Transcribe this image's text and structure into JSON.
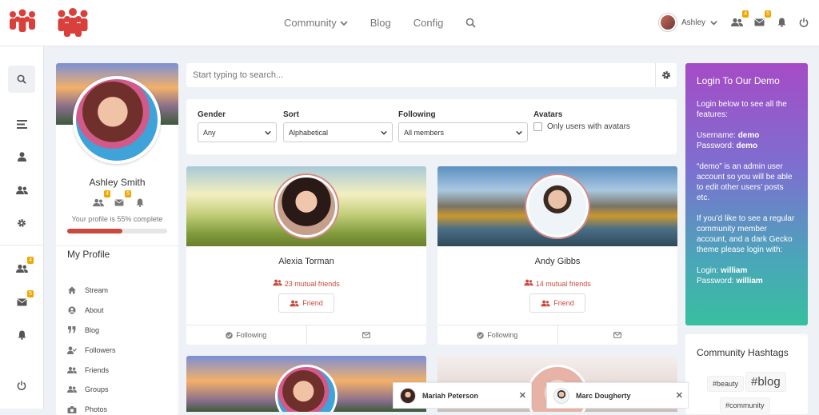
{
  "nav": {
    "community": "Community",
    "blog": "Blog",
    "config": "Config"
  },
  "user": {
    "name": "Ashley",
    "friend_requests_badge": "4",
    "messages_badge": "5"
  },
  "sidebar": {
    "friends_badge": "4",
    "messages_badge": "5"
  },
  "profile": {
    "name": "Ashley Smith",
    "friends_badge": "4",
    "messages_badge": "5",
    "completion_text": "Your profile is 55% complete",
    "completion_percent": 55,
    "menu_title": "My Profile",
    "menu": [
      {
        "label": "Stream",
        "icon": "home-icon"
      },
      {
        "label": "About",
        "icon": "user-circle-icon"
      },
      {
        "label": "Blog",
        "icon": "quote-icon"
      },
      {
        "label": "Followers",
        "icon": "user-check-icon"
      },
      {
        "label": "Friends",
        "icon": "users-icon"
      },
      {
        "label": "Groups",
        "icon": "users-icon"
      },
      {
        "label": "Photos",
        "icon": "camera-icon"
      }
    ]
  },
  "search": {
    "placeholder": "Start typing to search..."
  },
  "filters": {
    "gender_label": "Gender",
    "gender_value": "Any",
    "sort_label": "Sort",
    "sort_value": "Alphabetical",
    "following_label": "Following",
    "following_value": "All members",
    "avatars_label": "Avatars",
    "avatars_checkbox": "Only users with avatars"
  },
  "members": [
    {
      "name": "Alexia Torman",
      "mutual": "23 mutual friends",
      "friend_btn": "Friend",
      "following": "Following"
    },
    {
      "name": "Andy Gibbs",
      "mutual": "14 mutual friends",
      "friend_btn": "Friend",
      "following": "Following"
    }
  ],
  "demo": {
    "title": "Login To Our Demo",
    "intro": "Login below to see all the features:",
    "username_label": "Username:",
    "username": "demo",
    "password_label": "Password:",
    "password": "demo",
    "admin_note": "“demo” is an admin user account so you will be able to edit other users’ posts etc.",
    "regular_note": "If you’d like to see a regular community member account, and a dark Gecko theme please login with:",
    "login_label": "Login:",
    "login": "william",
    "password2_label": "Password:",
    "password2": "william"
  },
  "hashtags": {
    "title": "Community Hashtags",
    "tags": [
      "#beauty",
      "#blog",
      "#community"
    ]
  },
  "chats": [
    {
      "name": "Mariah Peterson"
    },
    {
      "name": "Marc Dougherty"
    }
  ]
}
